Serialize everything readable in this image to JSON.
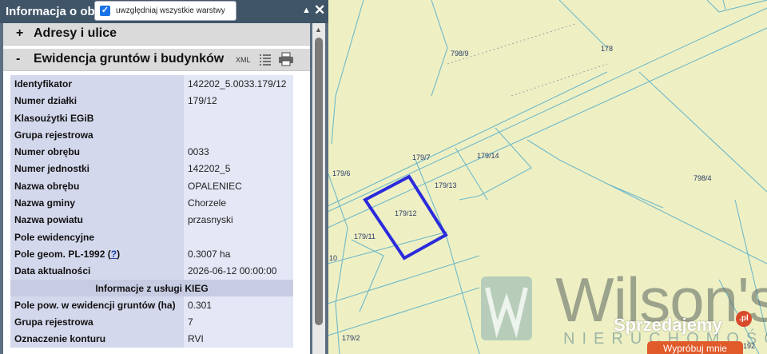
{
  "panel": {
    "title": "Informacja o ob",
    "layers_checkbox": {
      "label": "uwzględniaj wszystkie warstwy",
      "checked": true
    },
    "minimize_icon": "triangle-up-icon",
    "close_icon": "close-icon"
  },
  "sections": [
    {
      "sign": "+",
      "title": "Adresy i ulice",
      "expanded": false
    },
    {
      "sign": "-",
      "title": "Ewidencja gruntów i budynków",
      "expanded": true,
      "tools": [
        "xml-icon",
        "list-icon",
        "print-icon"
      ],
      "xml_label": "XML"
    }
  ],
  "attributes": [
    {
      "key": "Identyfikator",
      "value": "142202_5.0033.179/12"
    },
    {
      "key": "Numer działki",
      "value": "179/12"
    },
    {
      "key": "Klasoużytki EGiB",
      "value": ""
    },
    {
      "key": "Grupa rejestrowa",
      "value": ""
    },
    {
      "key": "Numer obrębu",
      "value": "0033"
    },
    {
      "key": "Numer jednostki",
      "value": "142202_5"
    },
    {
      "key": "Nazwa obrębu",
      "value": "OPALENIEC"
    },
    {
      "key": "Nazwa gminy",
      "value": "Chorzele"
    },
    {
      "key": "Nazwa powiatu",
      "value": "przasnyski"
    },
    {
      "key": "Pole ewidencyjne",
      "value": ""
    },
    {
      "key": "Pole geom. PL-1992",
      "help": "?",
      "value": "0.3007 ha"
    },
    {
      "key": "Data aktualności",
      "value": "2026-06-12 00:00:00"
    }
  ],
  "kieg": {
    "heading": "Informacje z usługi KIEG",
    "rows": [
      {
        "key": "Pole pow. w ewidencji gruntów (ha)",
        "value": "0.301"
      },
      {
        "key": "Grupa rejestrowa",
        "value": "7"
      },
      {
        "key": "Oznaczenie konturu",
        "value": "RVI"
      }
    ]
  },
  "map": {
    "parcel_labels": [
      "798/9",
      "178",
      "179/7",
      "179/14",
      "179/6",
      "179/13",
      "798/4",
      "179/12",
      "179/11",
      "10",
      "179/2",
      "192"
    ],
    "selected_parcel": "179/12",
    "selection_color": "#2b2bdc",
    "background_color": "#eef0c4",
    "line_color": "#6fb8c8"
  },
  "watermark": {
    "brand": "Wilson's",
    "sub": "NIERUCHOMOŚCI",
    "marketplace": "Sprzedajemy",
    "marketplace_badge": ".pl",
    "cta": "Wypróbuj mnie"
  }
}
